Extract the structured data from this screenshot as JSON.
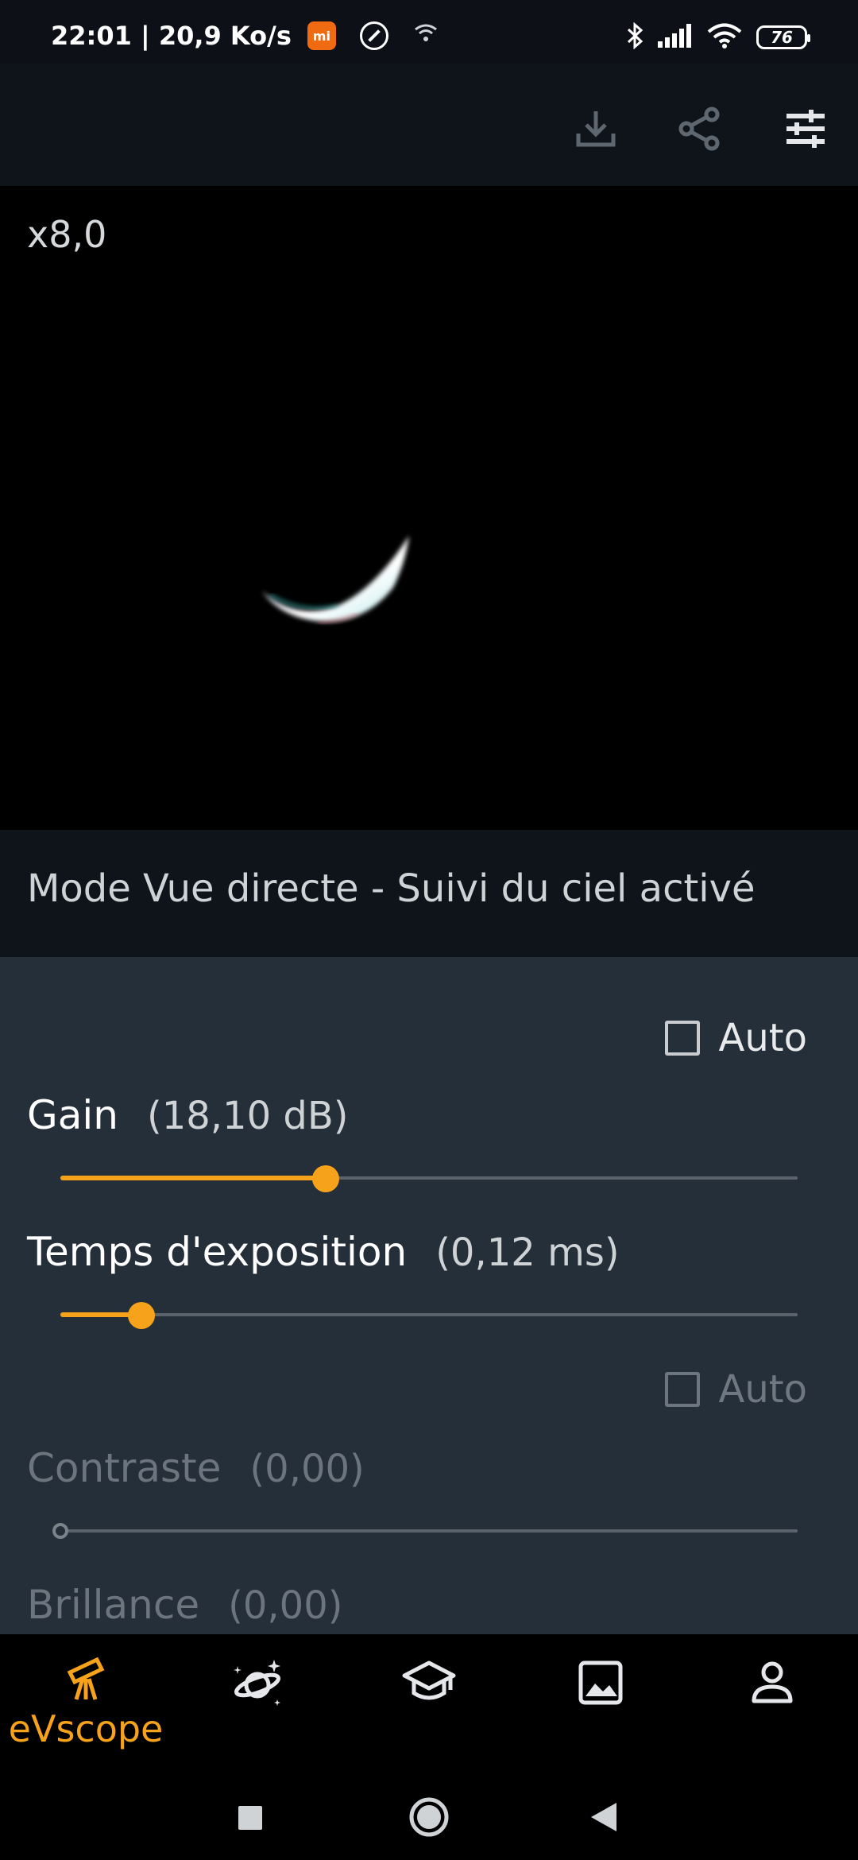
{
  "status_bar": {
    "time_speed": "22:01 | 20,9 Ko/s",
    "battery": "76",
    "app_badge": "mi"
  },
  "toolbar": {
    "icons": [
      "download-icon",
      "share-icon",
      "tune-icon"
    ]
  },
  "viewer": {
    "zoom": "x8,0"
  },
  "mode": {
    "text": "Mode Vue directe - Suivi du ciel activé"
  },
  "controls": {
    "auto_top": {
      "label": "Auto",
      "checked": false
    },
    "gain": {
      "label": "Gain",
      "value": "(18,10 dB)",
      "slider_fraction": 0.36
    },
    "exposure": {
      "label": "Temps d'exposition",
      "value": "(0,12 ms)",
      "slider_fraction": 0.11
    },
    "auto_bottom": {
      "label": "Auto",
      "checked": false,
      "disabled": true
    },
    "contrast": {
      "label": "Contraste",
      "value": "(0,00)",
      "slider_fraction": 0.0,
      "disabled": true
    },
    "brightness": {
      "label": "Brillance",
      "value": "(0,00)",
      "disabled": true
    }
  },
  "bottom_nav": {
    "items": [
      {
        "icon": "telescope-icon",
        "label": "eVscope",
        "active": true
      },
      {
        "icon": "planet-icon",
        "active": false
      },
      {
        "icon": "graduation-cap-icon",
        "active": false
      },
      {
        "icon": "image-icon",
        "active": false
      },
      {
        "icon": "person-icon",
        "active": false
      }
    ]
  },
  "colors": {
    "accent": "#f7a21b",
    "panel": "#252f3a",
    "bar": "#0f141a"
  }
}
